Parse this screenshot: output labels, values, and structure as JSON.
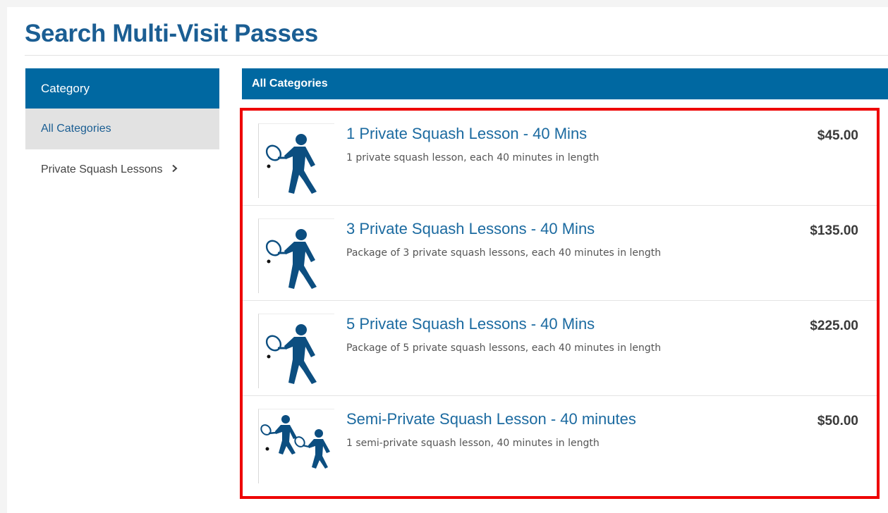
{
  "page": {
    "title": "Search Multi-Visit Passes"
  },
  "sidebar": {
    "header": "Category",
    "items": [
      {
        "label": "All Categories",
        "active": true
      },
      {
        "label": "Private Squash Lessons",
        "icon": "chevron-right-icon"
      }
    ]
  },
  "main": {
    "header": "All Categories",
    "passes": [
      {
        "name": "1 Private Squash Lesson - 40 Mins",
        "description": "1 private squash lesson, each 40 minutes in length",
        "price": "$45.00",
        "icon": "squash-player-icon"
      },
      {
        "name": "3 Private Squash Lessons - 40 Mins",
        "description": "Package of 3 private squash lessons, each 40 minutes in length",
        "price": "$135.00",
        "icon": "squash-player-icon"
      },
      {
        "name": "5 Private Squash Lessons - 40 Mins",
        "description": "Package of 5 private squash lessons, each 40 minutes in length",
        "price": "$225.00",
        "icon": "squash-player-icon"
      },
      {
        "name": "Semi-Private Squash Lesson - 40 minutes",
        "description": "1 semi-private squash lesson, 40 minutes in length",
        "price": "$50.00",
        "icon": "two-squash-players-icon"
      }
    ]
  },
  "colors": {
    "brand": "#0068a1",
    "title": "#1b5e93",
    "link": "#1b6aa0",
    "highlight_border": "#ee0000"
  }
}
